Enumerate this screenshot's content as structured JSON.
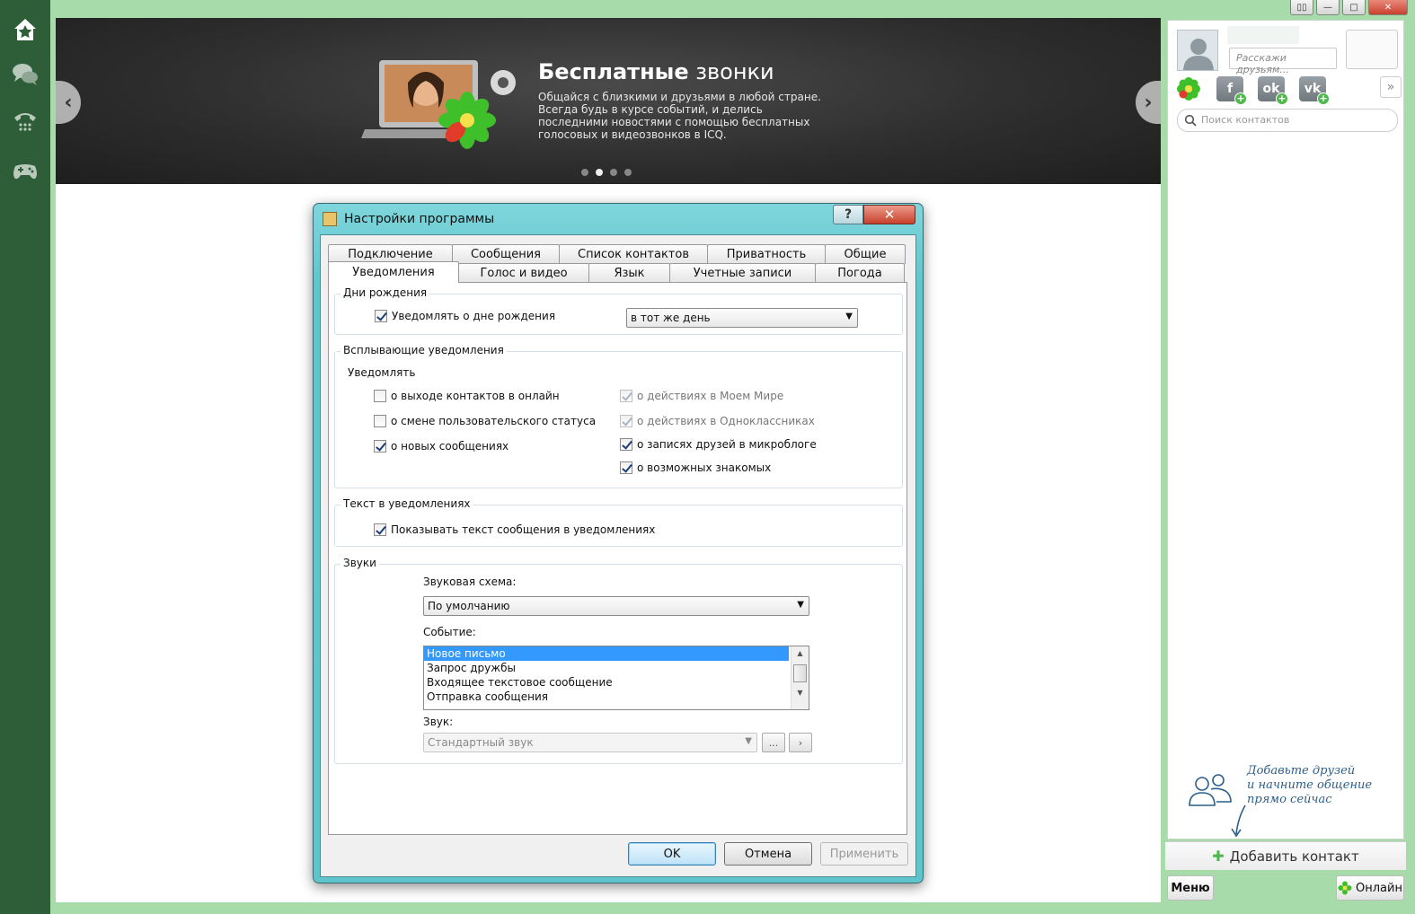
{
  "window": {
    "buttons": [
      "▯▯",
      "—",
      "□",
      "✕"
    ]
  },
  "leftnav": {
    "items": [
      {
        "icon": "home-star-icon"
      },
      {
        "icon": "chat-bubbles-icon"
      },
      {
        "icon": "phone-icon"
      },
      {
        "icon": "gamepad-icon"
      }
    ]
  },
  "banner": {
    "title_bold": "Бесплатные",
    "title_rest": " звонки",
    "text": "Общайся с близкими и друзьями в любой стране. Всегда будь в курсе событий, и делись последними новостями с помощью бесплатных голосовых и видеозвонков в ICQ.",
    "prev": "‹",
    "next": "›",
    "dots_total": 4,
    "dots_active": 2
  },
  "right_panel": {
    "status_placeholder": "Расскажи друзьям...",
    "search_placeholder": "Поиск контактов",
    "expand": "»",
    "social_icons": [
      "icq-flower-icon",
      "facebook-add-icon",
      "odnoklassniki-add-icon",
      "vkontakte-add-icon"
    ],
    "hint": "Добавьте друзей\nи начните общение\nпрямо сейчас",
    "add_contact": "Добавить контакт",
    "menu": "Меню",
    "status": "Онлайн"
  },
  "dialog": {
    "title": "Настройки программы",
    "help": "?",
    "close": "✕",
    "tabs_row1": [
      "Подключение",
      "Сообщения",
      "Список контактов",
      "Приватность",
      "Общие"
    ],
    "tabs_row2": [
      "Уведомления",
      "Голос и видео",
      "Язык",
      "Учетные записи",
      "Погода"
    ],
    "active_tab": "Уведомления",
    "birthdays": {
      "title": "Дни рождения",
      "notify_label": "Уведомлять о дне рождения",
      "notify_checked": true,
      "when_value": "в тот же день"
    },
    "popups": {
      "title": "Всплывающие уведомления",
      "subtitle": "Уведомлять",
      "left": [
        {
          "label": "о выходе контактов в онлайн",
          "checked": false
        },
        {
          "label": "о смене пользовательского статуса",
          "checked": false
        },
        {
          "label": "о новых сообщениях",
          "checked": true
        }
      ],
      "right": [
        {
          "label": "о действиях в Моем Мире",
          "checked": true,
          "disabled": true
        },
        {
          "label": "о действиях в Одноклассниках",
          "checked": true,
          "disabled": true
        },
        {
          "label": "о записях друзей в микроблоге",
          "checked": true,
          "disabled": false
        },
        {
          "label": "о возможных знакомых",
          "checked": true,
          "disabled": false
        }
      ]
    },
    "text_in_notifications": {
      "title": "Текст в уведомлениях",
      "label": "Показывать текст сообщения в уведомлениях",
      "checked": true
    },
    "sounds": {
      "title": "Звуки",
      "scheme_label": "Звуковая схема:",
      "scheme_value": "По умолчанию",
      "event_label": "Событие:",
      "events": [
        "Новое письмо",
        "Запрос дружбы",
        "Входящее текстовое сообщение",
        "Отправка сообщения"
      ],
      "selected_event": "Новое письмо",
      "sound_label": "Звук:",
      "sound_value": "Стандартный звук",
      "browse": "...",
      "play": "›"
    },
    "buttons": {
      "ok": "OK",
      "cancel": "Отмена",
      "apply": "Применить"
    }
  }
}
